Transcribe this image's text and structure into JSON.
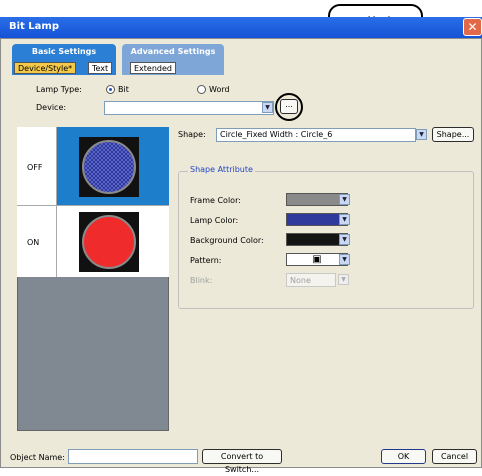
{
  "callout": {
    "text": "Click"
  },
  "window": {
    "title": "Bit Lamp",
    "close_glyph": "✕"
  },
  "tabs": {
    "basic": {
      "label": "Basic Settings",
      "subtabs": [
        "Device/Style*",
        "Text"
      ]
    },
    "advanced": {
      "label": "Advanced Settings",
      "subtabs": [
        "Extended"
      ]
    }
  },
  "lamp_type": {
    "label": "Lamp Type:",
    "options": [
      "Bit",
      "Word"
    ],
    "selected": "Bit"
  },
  "device": {
    "label": "Device:",
    "value": "",
    "browse_label": "..."
  },
  "states": {
    "off_label": "OFF",
    "on_label": "ON"
  },
  "shape": {
    "label": "Shape:",
    "value": "Circle_Fixed Width : Circle_6",
    "button_label": "Shape..."
  },
  "shape_attribute": {
    "title": "Shape Attribute",
    "frame_color": {
      "label": "Frame Color:",
      "color": "#8a8a8a"
    },
    "lamp_color": {
      "label": "Lamp Color:",
      "color": "#2f3a9c"
    },
    "background_color": {
      "label": "Background Color:",
      "color": "#141414"
    },
    "pattern": {
      "label": "Pattern:",
      "glyph": "▣"
    },
    "blink": {
      "label": "Blink:",
      "value": "None"
    }
  },
  "bottom": {
    "object_name_label": "Object Name:",
    "object_name_value": "",
    "convert_label": "Convert to Switch...",
    "ok_label": "OK",
    "cancel_label": "Cancel"
  },
  "colors": {
    "accent": "#1d7fcb",
    "title_bar": "#1553d6",
    "off_lamp": "#2f3a9c",
    "on_lamp": "#ef2b2b"
  }
}
